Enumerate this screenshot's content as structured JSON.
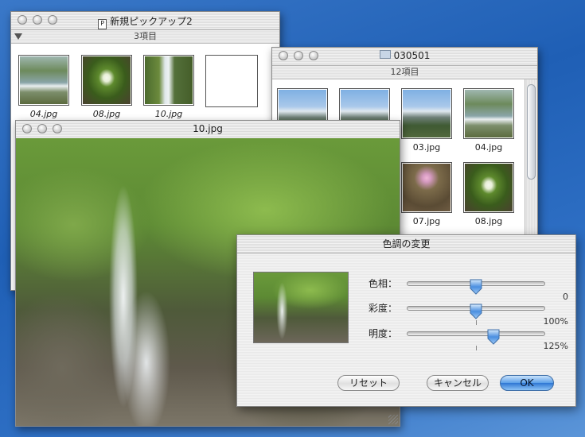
{
  "window_new": {
    "title": "新規ピックアップ2",
    "status": "3項目",
    "items": [
      {
        "name": "04.jpg"
      },
      {
        "name": "08.jpg"
      },
      {
        "name": "10.jpg"
      }
    ]
  },
  "window_folder": {
    "title": "030501",
    "status": "12項目",
    "items": [
      {
        "name": "03.jpg"
      },
      {
        "name": "04.jpg"
      },
      {
        "name": "07.jpg"
      },
      {
        "name": "08.jpg"
      }
    ]
  },
  "window_image": {
    "title": "10.jpg"
  },
  "dialog": {
    "title": "色調の変更",
    "sliders": [
      {
        "label": "色相：",
        "value_text": "0",
        "position": 0.5
      },
      {
        "label": "彩度：",
        "value_text": "100%",
        "position": 0.5
      },
      {
        "label": "明度：",
        "value_text": "125%",
        "position": 0.625
      }
    ],
    "buttons": {
      "reset": "リセット",
      "cancel": "キャンセル",
      "ok": "OK"
    }
  },
  "colors": {
    "desktop": "#2e6fc4",
    "ok_button": "#2f77d4",
    "slider_knob": "#4a8fe0"
  }
}
